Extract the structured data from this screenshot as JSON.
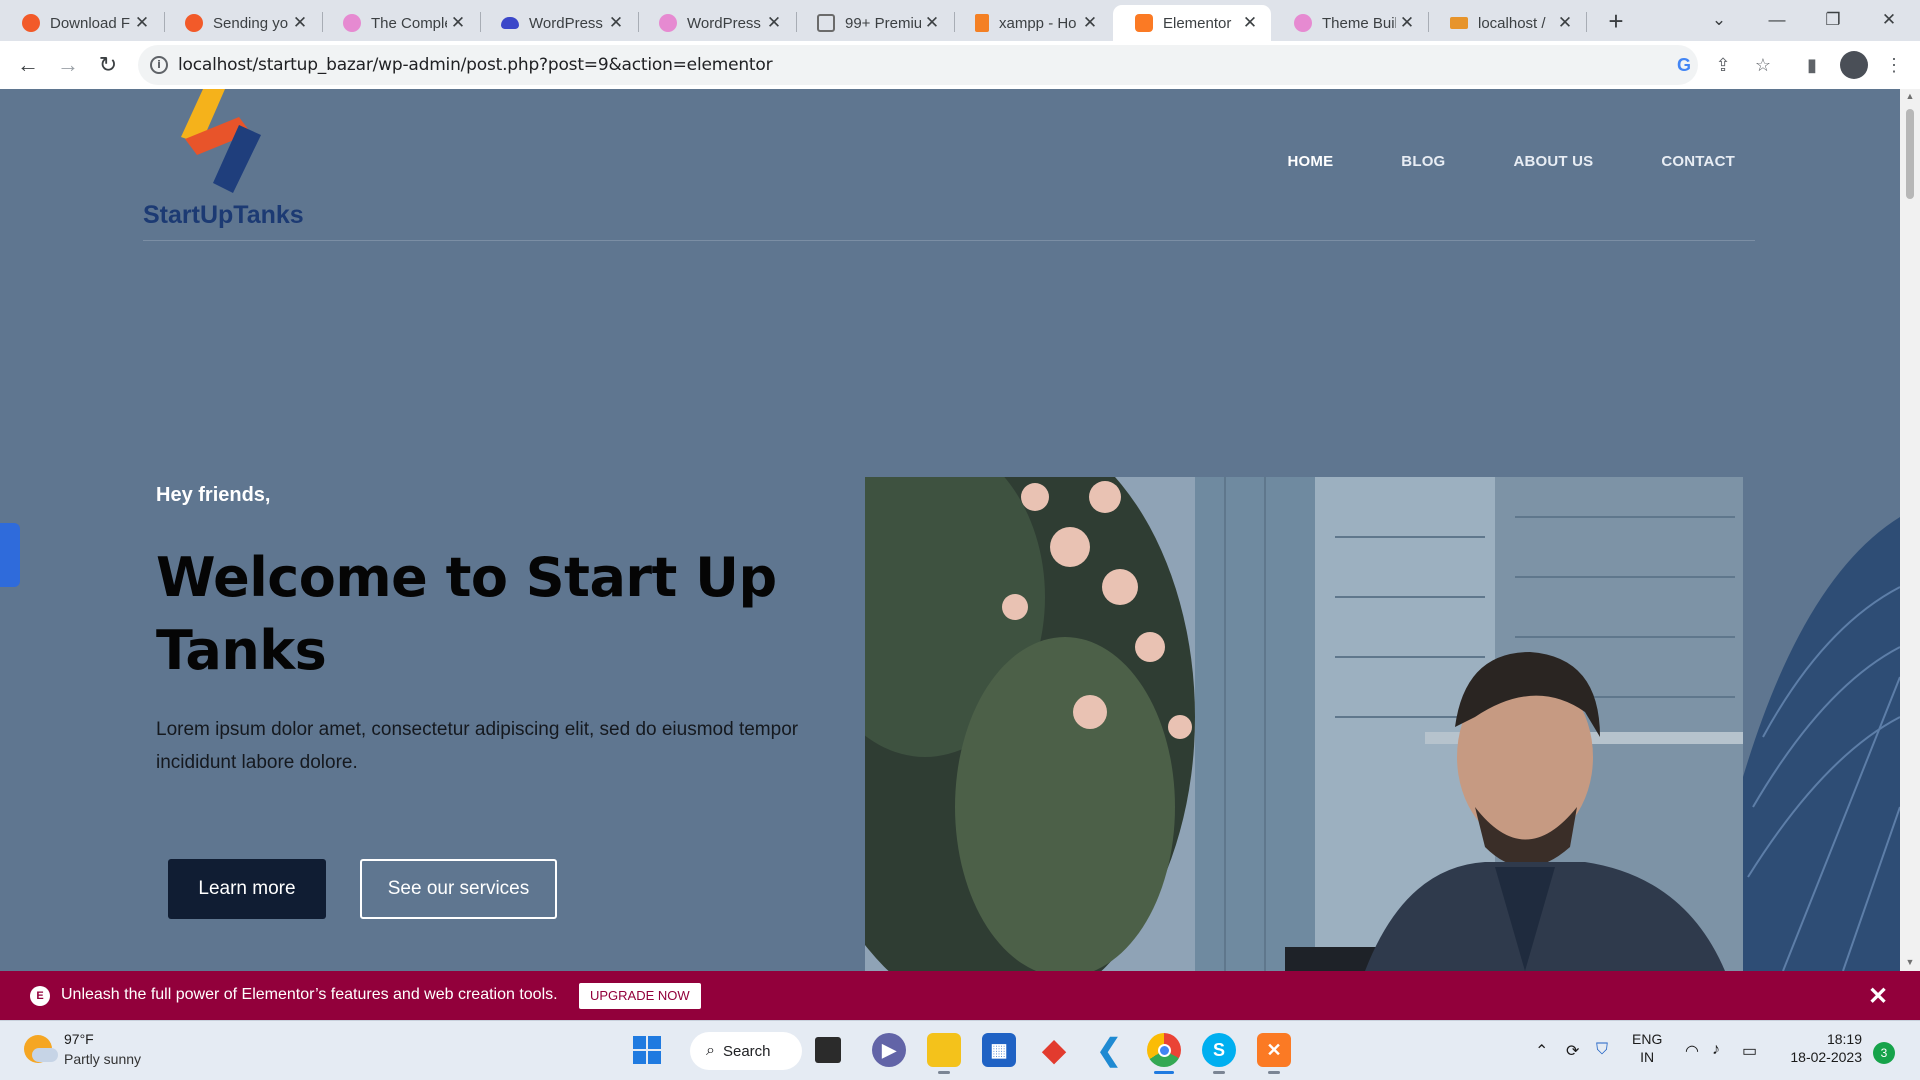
{
  "browser": {
    "tabs": [
      {
        "title": "Download F",
        "icon": "elementor-orange-icon",
        "color": "#f25a29"
      },
      {
        "title": "Sending yo",
        "icon": "elementor-orange-icon",
        "color": "#f25a29"
      },
      {
        "title": "The Comple",
        "icon": "elementor-pink-icon",
        "color": "#e68ad1"
      },
      {
        "title": "WordPress",
        "icon": "cloud-icon",
        "color": "#3b47c9"
      },
      {
        "title": "WordPress",
        "icon": "elementor-pink-icon",
        "color": "#e68ad1"
      },
      {
        "title": "99+ Premiu",
        "icon": "box-icon",
        "color": "#6b6b6b"
      },
      {
        "title": "xampp - Ho",
        "icon": "stackoverflow-icon",
        "color": "#f48024"
      },
      {
        "title": "Elementor",
        "icon": "xampp-icon",
        "color": "#fb7a24"
      },
      {
        "title": "Theme Buil",
        "icon": "elementor-pink-icon",
        "color": "#e68ad1"
      },
      {
        "title": "localhost /",
        "icon": "phpmyadmin-icon",
        "color": "#e7942b"
      }
    ],
    "active_tab": 7,
    "url": "localhost/startup_bazar/wp-admin/post.php?post=9&action=elementor"
  },
  "site": {
    "brand": "StartUpTanks",
    "menu": [
      "HOME",
      "BLOG",
      "ABOUT US",
      "CONTACT"
    ],
    "hero": {
      "eyebrow": "Hey friends,",
      "title_line1": "Welcome to Start Up",
      "title_line2": "Tanks",
      "text_line1": "Lorem ipsum dolor amet, consectetur adipiscing elit, sed do eiusmod tempor",
      "text_line2": "incididunt labore dolore.",
      "primary_button": "Learn more",
      "secondary_button": "See our services"
    }
  },
  "promo": {
    "message": "Unleash the full power of Elementor’s features and web creation tools.",
    "button": "UPGRADE NOW"
  },
  "taskbar": {
    "temperature": "97°F",
    "weather": "Partly sunny",
    "search": "Search",
    "language": "ENG",
    "region": "IN",
    "time": "18:19",
    "date": "18-02-2023",
    "notifications": "3"
  },
  "colors": {
    "page_overlay": "#5f7690",
    "brand_text": "#1c3a73",
    "promo_bar": "#92003b",
    "primary_button": "#101d33"
  }
}
